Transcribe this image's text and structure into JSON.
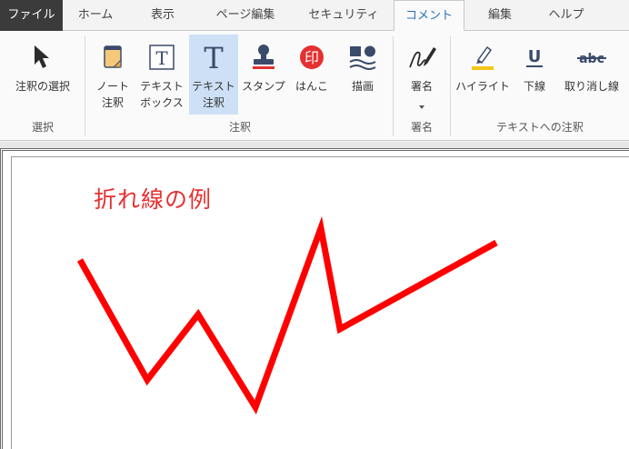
{
  "tabs": [
    {
      "label": "ファイル"
    },
    {
      "label": "ホーム"
    },
    {
      "label": "表示"
    },
    {
      "label": "ページ編集"
    },
    {
      "label": "セキュリティ"
    },
    {
      "label": "コメント"
    },
    {
      "label": "編集"
    },
    {
      "label": "ヘルプ"
    }
  ],
  "active_tab": "コメント",
  "ribbon": {
    "select_group": {
      "label": "選択",
      "select_annotation": "注釈の選択"
    },
    "annotation_group": {
      "label": "注釈",
      "note_line1": "ノート",
      "note_line2": "注釈",
      "textbox_line1": "テキスト",
      "textbox_line2": "ボックス",
      "textnote_line1": "テキスト",
      "textnote_line2": "注釈",
      "stamp": "スタンプ",
      "hanko": "はんこ",
      "drawing": "描画"
    },
    "signature_group": {
      "label": "署名",
      "signature": "署名"
    },
    "text_annotation_group": {
      "label": "テキストへの注釈",
      "highlight": "ハイライト",
      "underline": "下線",
      "strikethrough": "取り消し線",
      "underline_glyph": "U",
      "strike_glyph": "abc",
      "textbox_glyph": "T",
      "textnote_glyph": "T",
      "hanko_glyph": "印"
    }
  },
  "document": {
    "title": "折れ線の例",
    "line_color": "#ff0000",
    "title_color": "#e53030"
  },
  "colors": {
    "accent": "#2a6fbf",
    "selected_button": "#cde0f5",
    "file_tab": "#3b3b3b"
  }
}
